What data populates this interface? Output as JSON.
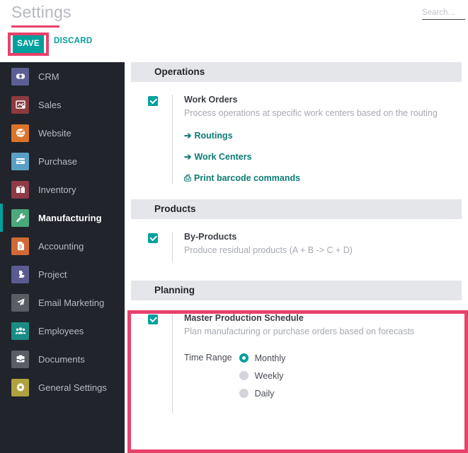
{
  "header": {
    "title": "Settings",
    "save_label": "SAVE",
    "discard_label": "DISCARD",
    "search_placeholder": "Search...",
    "search_value": ""
  },
  "colors": {
    "accent_teal": "#00a09d",
    "highlight_pink": "#e8416b",
    "sidebar_bg": "#21242b",
    "section_head_bg": "#e4e6ea",
    "link_teal": "#0c7c74"
  },
  "sidebar": {
    "items": [
      {
        "label": "CRM",
        "icon": "handshake-icon",
        "icon_color": "#5b5f93",
        "active": false
      },
      {
        "label": "Sales",
        "icon": "sales-chart-icon",
        "icon_color": "#8c3b40",
        "active": false
      },
      {
        "label": "Website",
        "icon": "globe-icon",
        "icon_color": "#db742b",
        "active": false
      },
      {
        "label": "Purchase",
        "icon": "credit-card-icon",
        "icon_color": "#5b9fc4",
        "active": false
      },
      {
        "label": "Inventory",
        "icon": "box-icon",
        "icon_color": "#8c3b47",
        "active": false
      },
      {
        "label": "Manufacturing",
        "icon": "wrench-icon",
        "icon_color": "#4aa87a",
        "active": true
      },
      {
        "label": "Accounting",
        "icon": "invoice-icon",
        "icon_color": "#cf6a36",
        "active": false
      },
      {
        "label": "Project",
        "icon": "puzzle-icon",
        "icon_color": "#5a5b90",
        "active": false
      },
      {
        "label": "Email Marketing",
        "icon": "paper-plane-icon",
        "icon_color": "#5a5d64",
        "active": false
      },
      {
        "label": "Employees",
        "icon": "people-icon",
        "icon_color": "#1a8c84",
        "active": false
      },
      {
        "label": "Documents",
        "icon": "documents-tray-icon",
        "icon_color": "#5a5d64",
        "active": false
      },
      {
        "label": "General Settings",
        "icon": "gear-icon",
        "icon_color": "#b0a23e",
        "active": false
      }
    ]
  },
  "sections": {
    "operations": {
      "heading": "Operations",
      "setting": {
        "title": "Work Orders",
        "description": "Process operations at specific work centers based on the routing",
        "checked": true
      },
      "links": [
        {
          "label": "Routings",
          "icon": "arrow-right-icon",
          "glyph": "➔"
        },
        {
          "label": "Work Centers",
          "icon": "arrow-right-icon",
          "glyph": "➔"
        },
        {
          "label": "Print barcode commands",
          "icon": "printer-icon",
          "glyph": "⎙"
        }
      ]
    },
    "products": {
      "heading": "Products",
      "setting": {
        "title": "By-Products",
        "description": "Produce residual products (A + B -> C + D)",
        "checked": true
      }
    },
    "planning": {
      "heading": "Planning",
      "setting": {
        "title": "Master Production Schedule",
        "description": "Plan manufacturing or purchase orders based on forecasts",
        "checked": true
      },
      "time_range": {
        "label": "Time Range",
        "options": [
          {
            "label": "Monthly",
            "selected": true
          },
          {
            "label": "Weekly",
            "selected": false
          },
          {
            "label": "Daily",
            "selected": false
          }
        ]
      }
    }
  }
}
